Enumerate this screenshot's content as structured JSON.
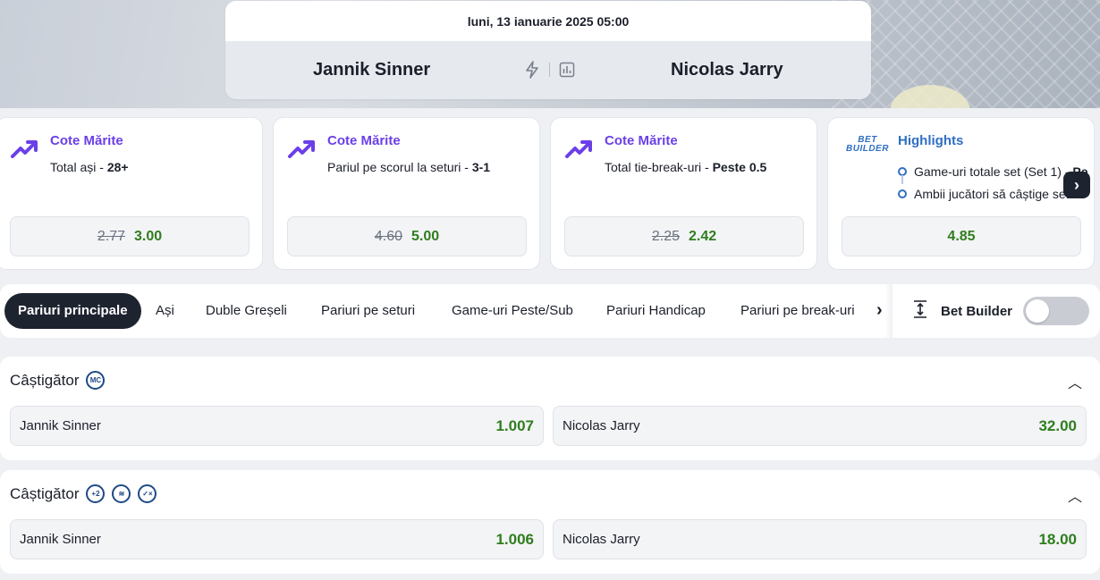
{
  "event": {
    "date": "luni, 13 ianuarie 2025 05:00",
    "home": "Jannik Sinner",
    "away": "Nicolas Jarry",
    "icons": [
      "lightning-icon",
      "stats-icon"
    ]
  },
  "promos": [
    {
      "title": "Cote Mărite",
      "desc": "Total ași - ",
      "desc_bold": "28+",
      "old_odd": "2.77",
      "new_odd": "3.00",
      "icon": "trend-up-icon"
    },
    {
      "title": "Cote Mărite",
      "desc": "Pariul pe scorul la seturi - ",
      "desc_bold": "3-1",
      "old_odd": "4.60",
      "new_odd": "5.00",
      "icon": "trend-up-icon"
    },
    {
      "title": "Cote Mărite",
      "desc": "Total tie-break-uri - ",
      "desc_bold": "Peste 0.5",
      "old_odd": "2.25",
      "new_odd": "2.42",
      "icon": "trend-up-icon"
    }
  ],
  "highlight": {
    "logo_line1": "BET",
    "logo_line2": "BUILDER",
    "title": "Highlights",
    "item1": "Game-uri totale set (Set 1) - ",
    "item1_bold": "Pe",
    "item2": "Ambii jucători să câștige set",
    "odd": "4.85"
  },
  "tabs": {
    "items": [
      "Pariuri principale",
      "Ași",
      "Duble Greșeli",
      "Pariuri pe seturi",
      "Game-uri Peste/Sub",
      "Pariuri Handicap",
      "Pariuri pe break-uri"
    ],
    "bet_builder_label": "Bet Builder"
  },
  "markets": [
    {
      "title": "Câștigător",
      "badges": [
        "MC"
      ],
      "home": "Jannik Sinner",
      "home_odd": "1.007",
      "away": "Nicolas Jarry",
      "away_odd": "32.00"
    },
    {
      "title": "Câștigător",
      "badges": [
        "+2",
        "≋",
        "✓×"
      ],
      "home": "Jannik Sinner",
      "home_odd": "1.006",
      "away": "Nicolas Jarry",
      "away_odd": "18.00"
    }
  ],
  "colors": {
    "promo_title": "#6b3fe8",
    "odds_green": "#2f7d1e",
    "highlight_blue": "#2f6fc4",
    "dark": "#1e2330"
  }
}
